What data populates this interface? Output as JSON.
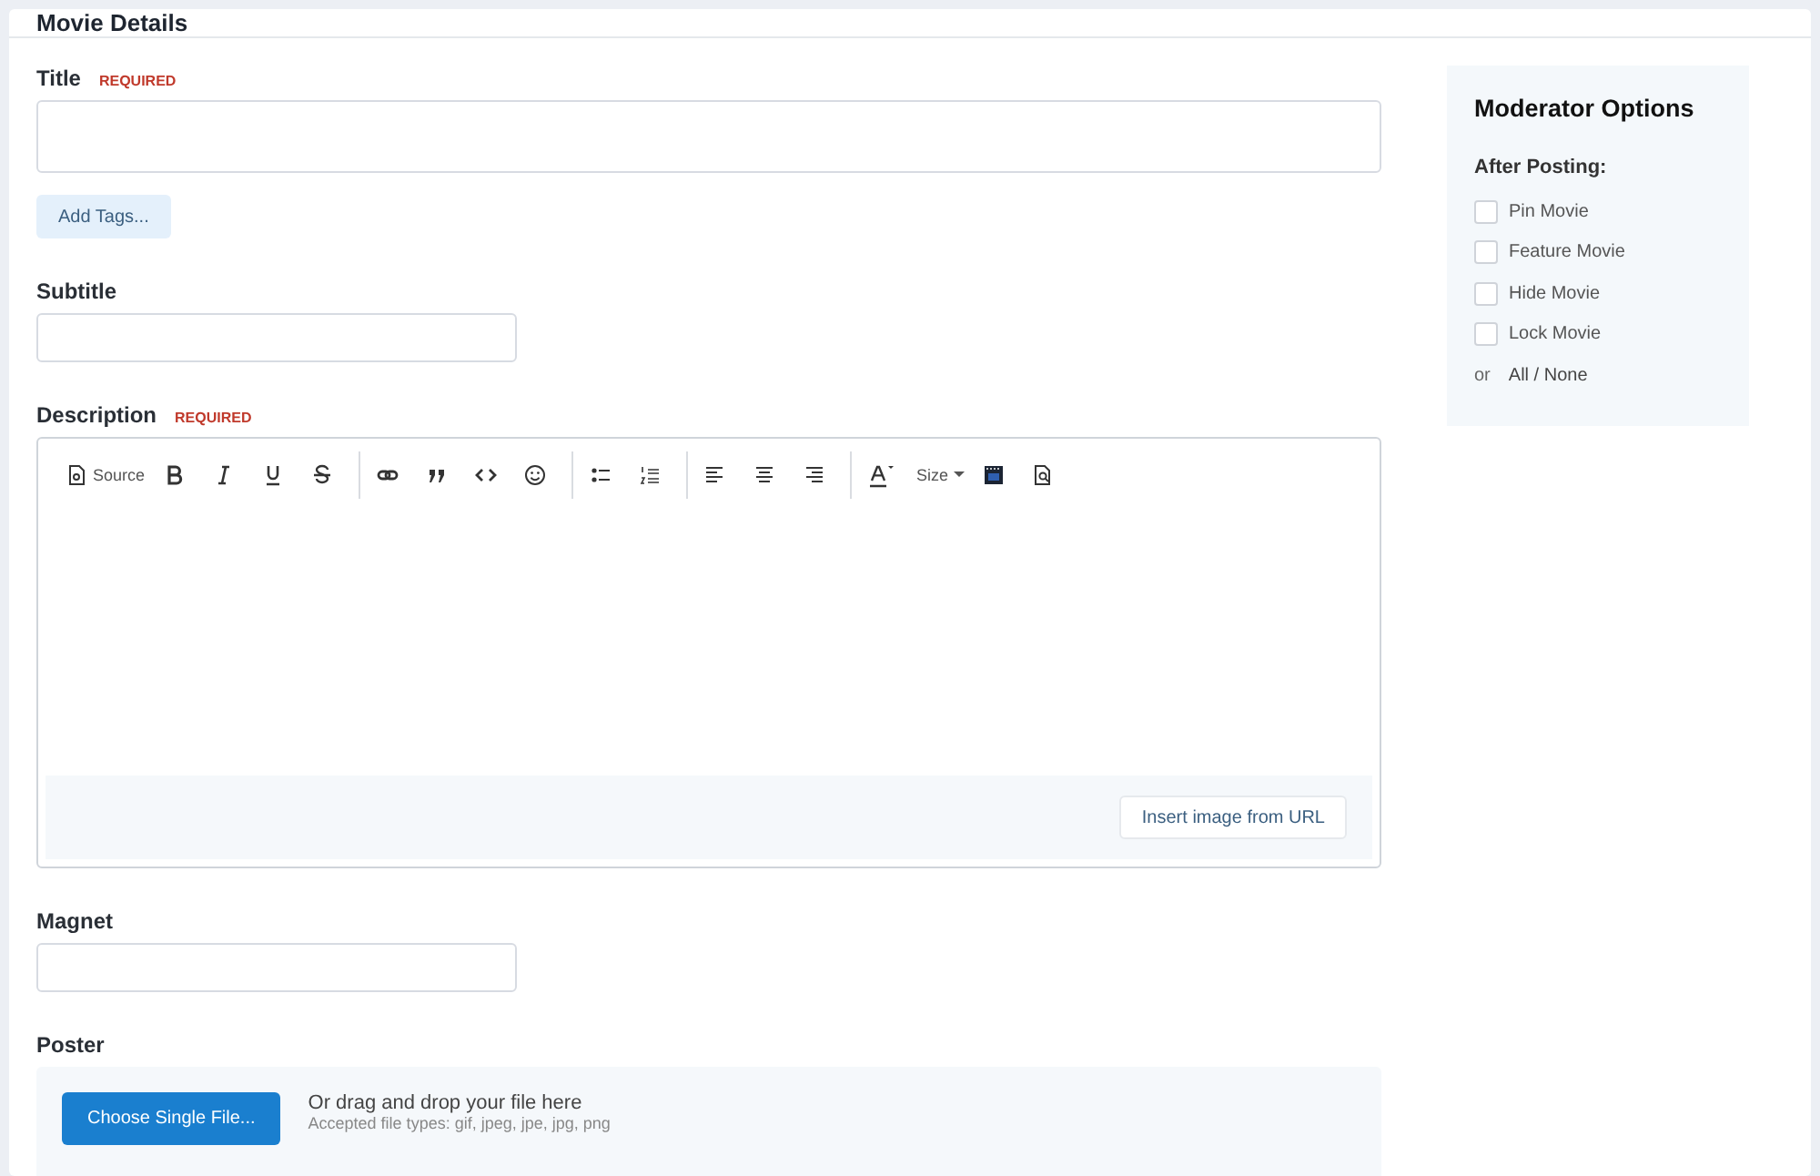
{
  "card": {
    "title": "Movie Details"
  },
  "title_field": {
    "label": "Title",
    "required": "REQUIRED"
  },
  "add_tags": "Add Tags...",
  "subtitle_field": {
    "label": "Subtitle"
  },
  "description": {
    "label": "Description",
    "required": "REQUIRED",
    "toolbar": [
      [
        {
          "kind": "source",
          "label": "Source"
        },
        {
          "kind": "bold"
        },
        {
          "kind": "italic"
        },
        {
          "kind": "underline"
        },
        {
          "kind": "strike"
        }
      ],
      [
        {
          "kind": "link"
        },
        {
          "kind": "quote"
        },
        {
          "kind": "code"
        },
        {
          "kind": "emoji"
        }
      ],
      [
        {
          "kind": "bullets"
        },
        {
          "kind": "numbers"
        }
      ],
      [
        {
          "kind": "align-left"
        },
        {
          "kind": "align-center"
        },
        {
          "kind": "align-right"
        }
      ],
      [
        {
          "kind": "color"
        },
        {
          "kind": "size",
          "label": "Size"
        },
        {
          "kind": "media"
        },
        {
          "kind": "preview"
        }
      ]
    ],
    "insert_image": "Insert image from URL"
  },
  "magnet_field": {
    "label": "Magnet"
  },
  "poster": {
    "label": "Poster",
    "button": "Choose Single File...",
    "hint": "Or drag and drop your file here",
    "types": "Accepted file types: gif, jpeg, jpe, jpg, png"
  },
  "moderator": {
    "title": "Moderator Options",
    "subtitle": "After Posting:",
    "options": [
      {
        "label": "Pin Movie",
        "checked": false
      },
      {
        "label": "Feature Movie",
        "checked": false
      },
      {
        "label": "Hide Movie",
        "checked": false
      },
      {
        "label": "Lock Movie",
        "checked": false
      }
    ],
    "or": "or",
    "all_none": "All / None"
  }
}
